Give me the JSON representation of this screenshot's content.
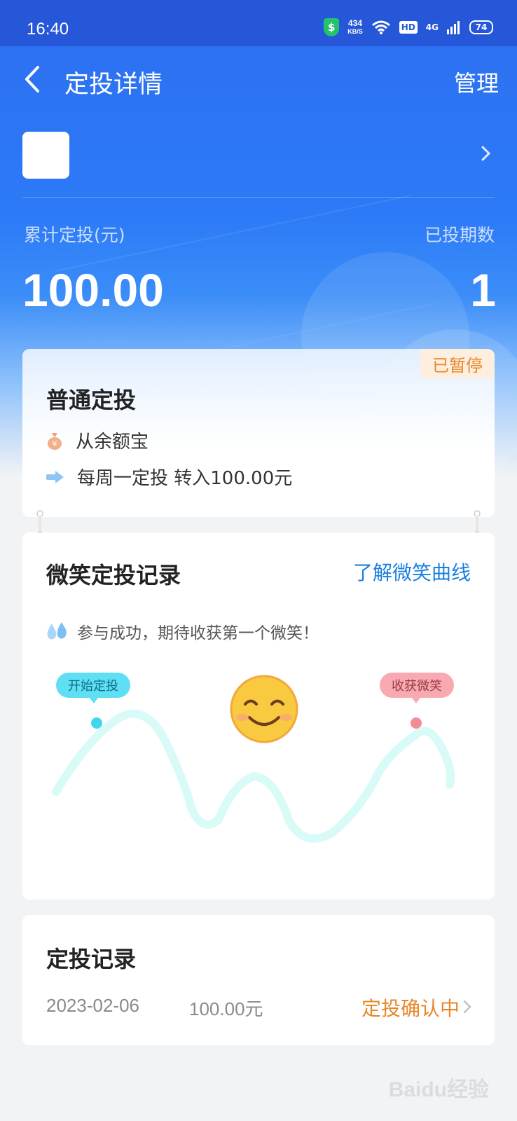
{
  "status_bar": {
    "time": "16:40",
    "speed_value": "434",
    "speed_unit": "KB/S",
    "hd": "HD",
    "network": "4G",
    "battery": "74"
  },
  "nav": {
    "title": "定投详情",
    "manage": "管理"
  },
  "stats": {
    "total_label": "累计定投(元)",
    "total_value": "100.00",
    "periods_label": "已投期数",
    "periods_value": "1"
  },
  "plan": {
    "status_badge": "已暂停",
    "title": "普通定投",
    "source": "从余额宝",
    "schedule": "每周一定投 转入100.00元"
  },
  "smile": {
    "title": "微笑定投记录",
    "link": "了解微笑曲线",
    "tip": "参与成功，期待收获第一个微笑！",
    "start_label": "开始定投",
    "harvest_label": "收获微笑",
    "emoji": "😊"
  },
  "records": {
    "title": "定投记录",
    "items": [
      {
        "date": "2023-02-06",
        "amount": "100.00元",
        "status": "定投确认中"
      }
    ]
  },
  "watermark": "Baidu经验",
  "colors": {
    "primary_blue": "#2c7af7",
    "status_bar": "#2557d8",
    "orange": "#e8862a",
    "link_blue": "#1a7fe0",
    "curve": "#d8fbf7",
    "start_marker": "#3fd6ee",
    "harvest_marker": "#f48c97"
  }
}
